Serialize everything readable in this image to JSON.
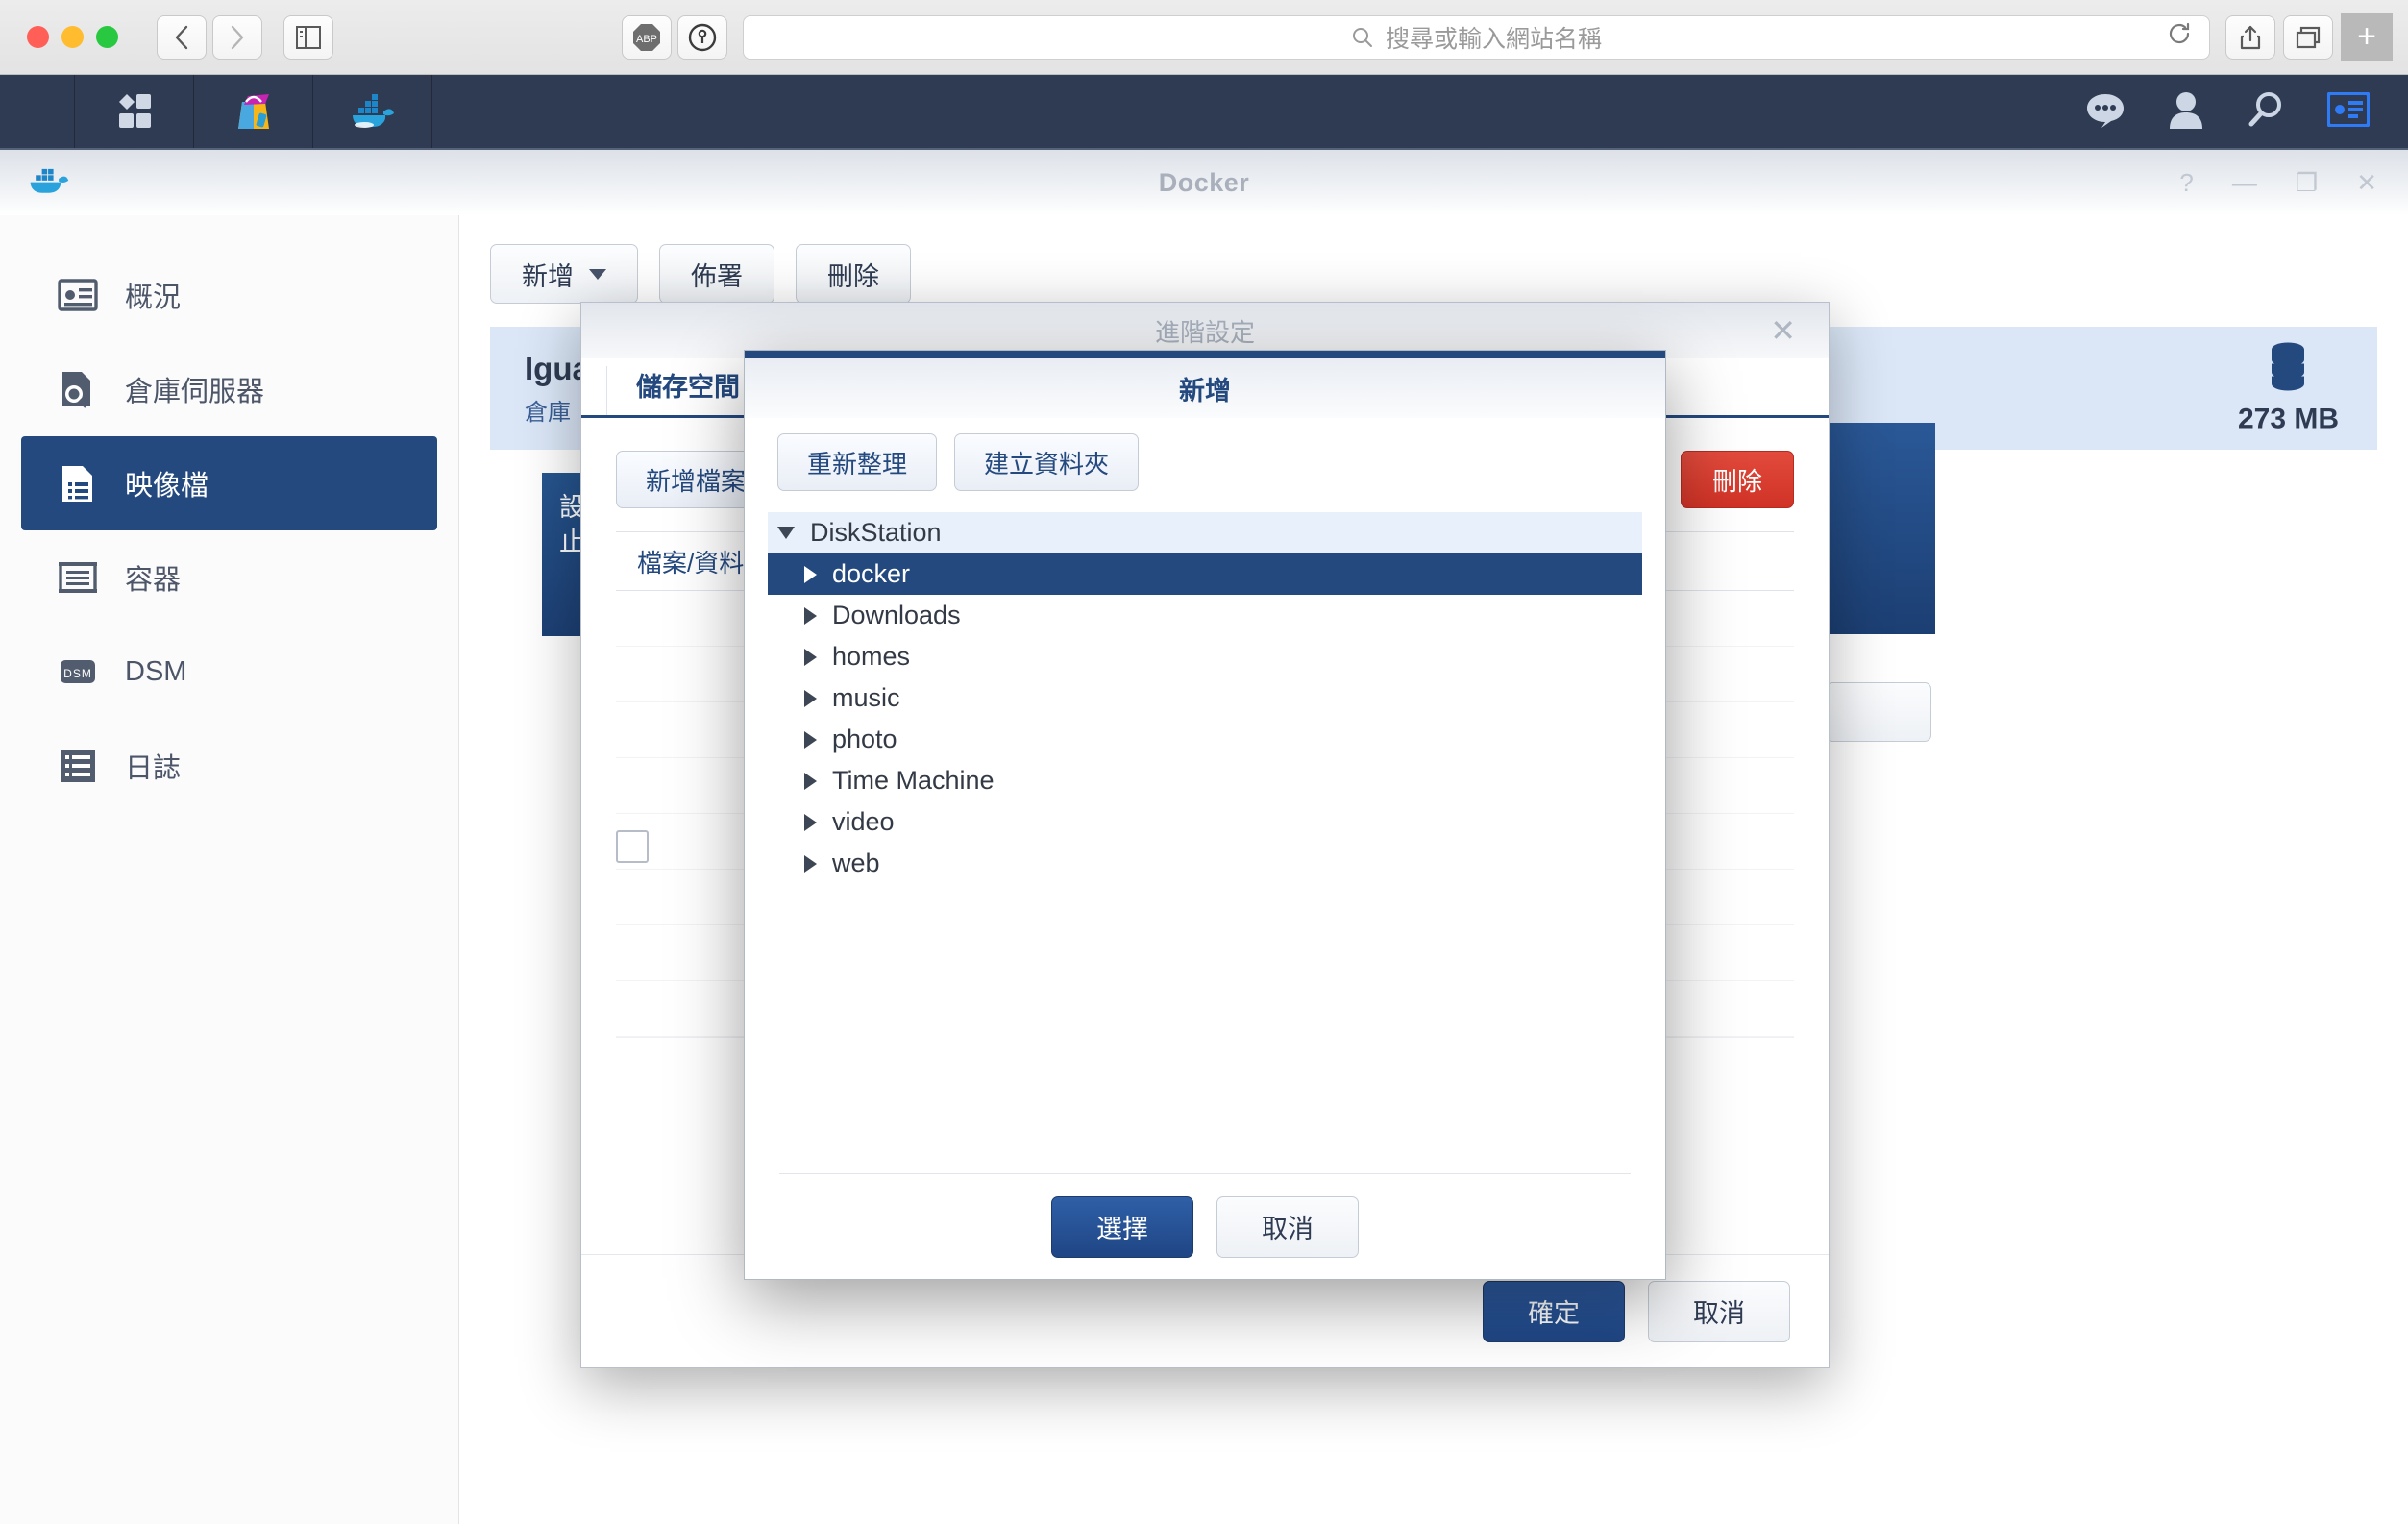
{
  "browser": {
    "address_placeholder": "搜尋或輸入網站名稱",
    "extensions": [
      "ABP",
      "1password-icon"
    ],
    "icons": {
      "back": "back-icon",
      "forward": "forward-icon",
      "sidebar": "sidebar-icon",
      "reload": "reload-icon",
      "share": "share-icon",
      "tabs": "tab-overview-icon",
      "newtab": "new-tab-icon",
      "search": "search-icon"
    }
  },
  "dsm_taskbar": {
    "left_icons": [
      "main-menu-icon",
      "package-center-icon",
      "docker-icon"
    ],
    "right_icons": [
      "notifications-icon",
      "user-icon",
      "search-icon",
      "widgets-icon"
    ]
  },
  "app": {
    "title": "Docker",
    "window_controls": [
      "?",
      "—",
      "❐",
      "✕"
    ],
    "sidebar": [
      {
        "label": "概況",
        "icon": "overview-icon",
        "active": false
      },
      {
        "label": "倉庫伺服器",
        "icon": "registry-icon",
        "active": false
      },
      {
        "label": "映像檔",
        "icon": "image-icon",
        "active": true
      },
      {
        "label": "容器",
        "icon": "container-icon",
        "active": false
      },
      {
        "label": "DSM",
        "icon": "dsm-icon",
        "active": false
      },
      {
        "label": "日誌",
        "icon": "log-icon",
        "active": false
      }
    ],
    "toolbar": [
      {
        "label": "新增",
        "has_dropdown": true
      },
      {
        "label": "佈署",
        "has_dropdown": false
      },
      {
        "label": "刪除",
        "has_dropdown": false
      }
    ],
    "image_card": {
      "name": "Igua",
      "subtitle": "倉庫",
      "size": "273 MB",
      "size_icon": "database-icon"
    }
  },
  "advanced_dialog": {
    "title": "進階設定",
    "close_icon": "close-icon",
    "tabs": [
      {
        "label": "儲存空間",
        "active": true
      }
    ],
    "add_folder_button": "新增檔案",
    "delete_button": "刪除",
    "table_headers": [
      "檔案/資料夾",
      ""
    ],
    "footer": {
      "ok": "確定",
      "cancel": "取消"
    }
  },
  "folder_picker": {
    "title": "新增",
    "buttons": {
      "refresh": "重新整理",
      "create_folder": "建立資料夾"
    },
    "tree": [
      {
        "label": "DiskStation",
        "depth": 0,
        "expanded": true,
        "state": "root"
      },
      {
        "label": "docker",
        "depth": 1,
        "expanded": false,
        "state": "selected"
      },
      {
        "label": "Downloads",
        "depth": 1,
        "expanded": false,
        "state": "normal"
      },
      {
        "label": "homes",
        "depth": 1,
        "expanded": false,
        "state": "normal"
      },
      {
        "label": "music",
        "depth": 1,
        "expanded": false,
        "state": "normal"
      },
      {
        "label": "photo",
        "depth": 1,
        "expanded": false,
        "state": "normal"
      },
      {
        "label": "Time Machine",
        "depth": 1,
        "expanded": false,
        "state": "normal"
      },
      {
        "label": "video",
        "depth": 1,
        "expanded": false,
        "state": "normal"
      },
      {
        "label": "web",
        "depth": 1,
        "expanded": false,
        "state": "normal"
      }
    ],
    "footer": {
      "select": "選擇",
      "cancel": "取消"
    }
  },
  "colors": {
    "accent": "#24497f",
    "taskbar": "#2e3b52",
    "danger": "#d03226",
    "card_bg": "#dbe7f7"
  }
}
